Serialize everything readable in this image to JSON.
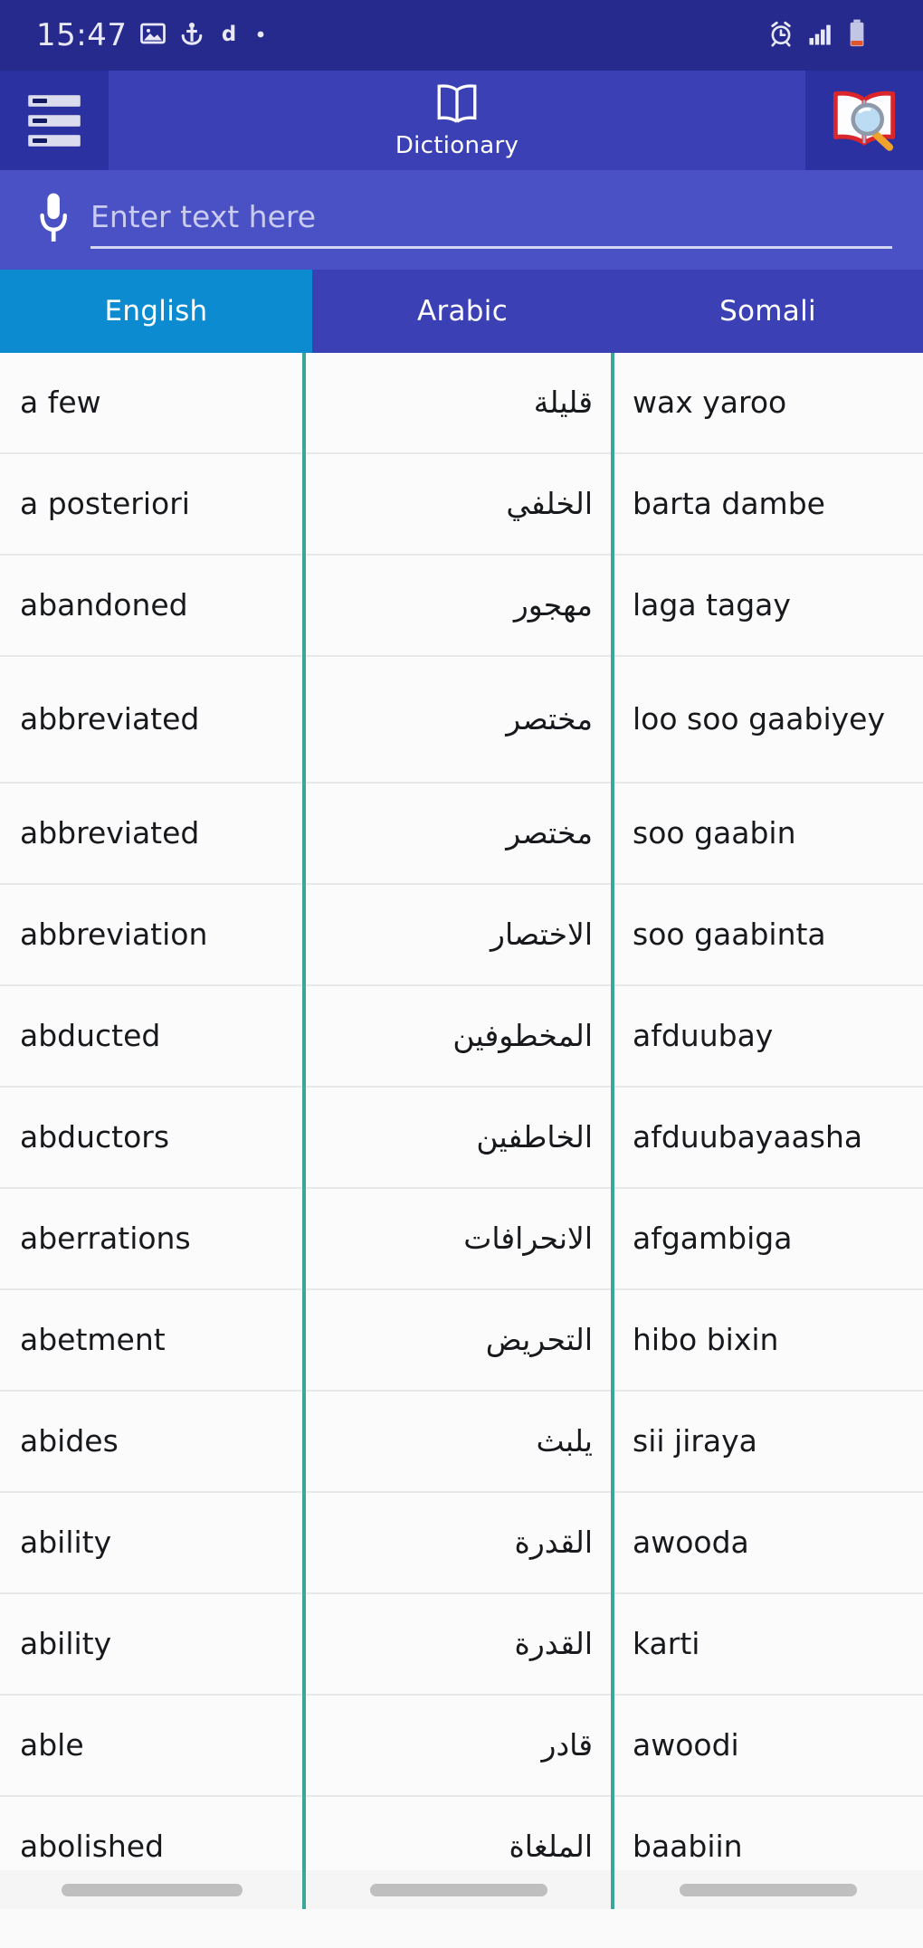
{
  "status_bar": {
    "time": "15:47",
    "left_icons": [
      "image-icon",
      "anchor-icon",
      "letter-d-icon",
      "dot-icon"
    ],
    "right_icons": [
      "alarm-icon",
      "signal-bars-icon",
      "battery-low-icon"
    ],
    "background_color": "#262a8c"
  },
  "app_bar": {
    "menu_icon": "hamburger-list-icon",
    "title": "Dictionary",
    "title_icon": "open-book-icon",
    "search_icon": "book-search-icon",
    "background_color": "#2b31a0",
    "title_background_color": "#3b41b4"
  },
  "search": {
    "mic_icon": "microphone-icon",
    "value": "",
    "placeholder": "Enter text here",
    "background_color": "#4a51c4"
  },
  "columns": {
    "active_index": 0,
    "active_color": "#0d8bd0",
    "inactive_color": "#3b41b4",
    "headers": [
      "English",
      "Arabic",
      "Somali"
    ]
  },
  "divider_color": "#3aa79b",
  "rows": [
    {
      "english": "a few",
      "arabic": "قليلة",
      "somali": "wax yaroo",
      "tall": false
    },
    {
      "english": "a posteriori",
      "arabic": "الخلفي",
      "somali": "barta dambe",
      "tall": false
    },
    {
      "english": "abandoned",
      "arabic": "مهجور",
      "somali": "laga tagay",
      "tall": false
    },
    {
      "english": "abbreviated",
      "arabic": "مختصر",
      "somali": "loo soo gaabiyey",
      "tall": true
    },
    {
      "english": "abbreviated",
      "arabic": "مختصر",
      "somali": "soo gaabin",
      "tall": false
    },
    {
      "english": "abbreviation",
      "arabic": "الاختصار",
      "somali": "soo gaabinta",
      "tall": false
    },
    {
      "english": "abducted",
      "arabic": "المخطوفين",
      "somali": "afduubay",
      "tall": false
    },
    {
      "english": "abductors",
      "arabic": "الخاطفين",
      "somali": "afduubayaasha",
      "tall": false
    },
    {
      "english": "aberrations",
      "arabic": "الانحرافات",
      "somali": "afgambiga",
      "tall": false
    },
    {
      "english": "abetment",
      "arabic": "التحريض",
      "somali": "hibo bixin",
      "tall": false
    },
    {
      "english": "abides",
      "arabic": "يلبث",
      "somali": "sii jiraya",
      "tall": false
    },
    {
      "english": "ability",
      "arabic": "القدرة",
      "somali": "awooda",
      "tall": false
    },
    {
      "english": "ability",
      "arabic": "القدرة",
      "somali": "karti",
      "tall": false
    },
    {
      "english": "able",
      "arabic": "قادر",
      "somali": "awoodi",
      "tall": false
    },
    {
      "english": "abolished",
      "arabic": "الملغاة",
      "somali": "baabiin",
      "tall": false
    }
  ],
  "bottom_scrollbars": [
    "english-column-scroll",
    "arabic-column-scroll",
    "somali-column-scroll"
  ]
}
